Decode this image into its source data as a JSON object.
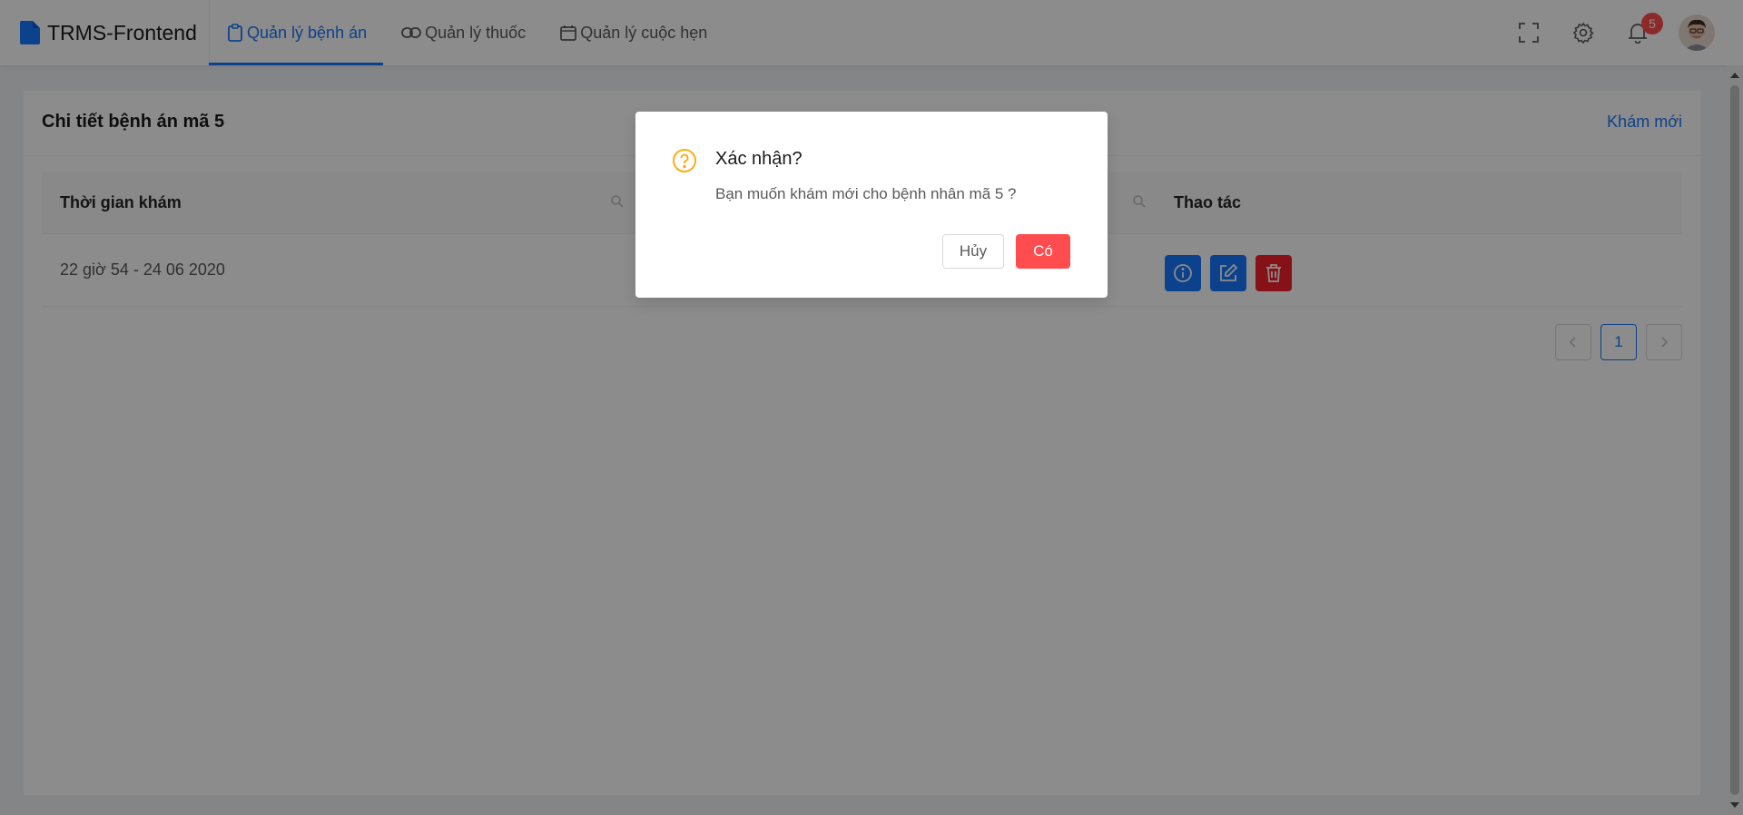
{
  "app": {
    "title": "TRMS-Frontend",
    "logo_icon": "file-icon",
    "accent_color": "#1677ff",
    "danger_color": "#ff4d4f"
  },
  "nav": {
    "items": [
      {
        "label": "Quản lý bệnh án",
        "icon": "clipboard-icon",
        "active": true
      },
      {
        "label": "Quản lý thuốc",
        "icon": "link-icon",
        "active": false
      },
      {
        "label": "Quản lý cuộc hẹn",
        "icon": "calendar-icon",
        "active": false
      }
    ]
  },
  "header_right": {
    "fullscreen_icon": "fullscreen-icon",
    "settings_icon": "gear-icon",
    "notification_icon": "bell-icon",
    "notification_count": "5",
    "avatar": "user-avatar"
  },
  "card": {
    "title": "Chi tiết bệnh án mã 5",
    "extra_link": "Khám mới"
  },
  "table": {
    "columns": [
      "Thời gian khám",
      "",
      "Thao tác"
    ],
    "rows": [
      {
        "exam_time": "22 giờ 54 - 24 06 2020",
        "actions": [
          "info-icon",
          "edit-icon",
          "delete-icon"
        ]
      }
    ]
  },
  "pagination": {
    "current_page": "1"
  },
  "modal": {
    "icon": "question-circle-icon",
    "title": "Xác nhận?",
    "content": "Bạn muốn khám mới cho bệnh nhân mã 5 ?",
    "cancel_label": "Hủy",
    "ok_label": "Có"
  }
}
